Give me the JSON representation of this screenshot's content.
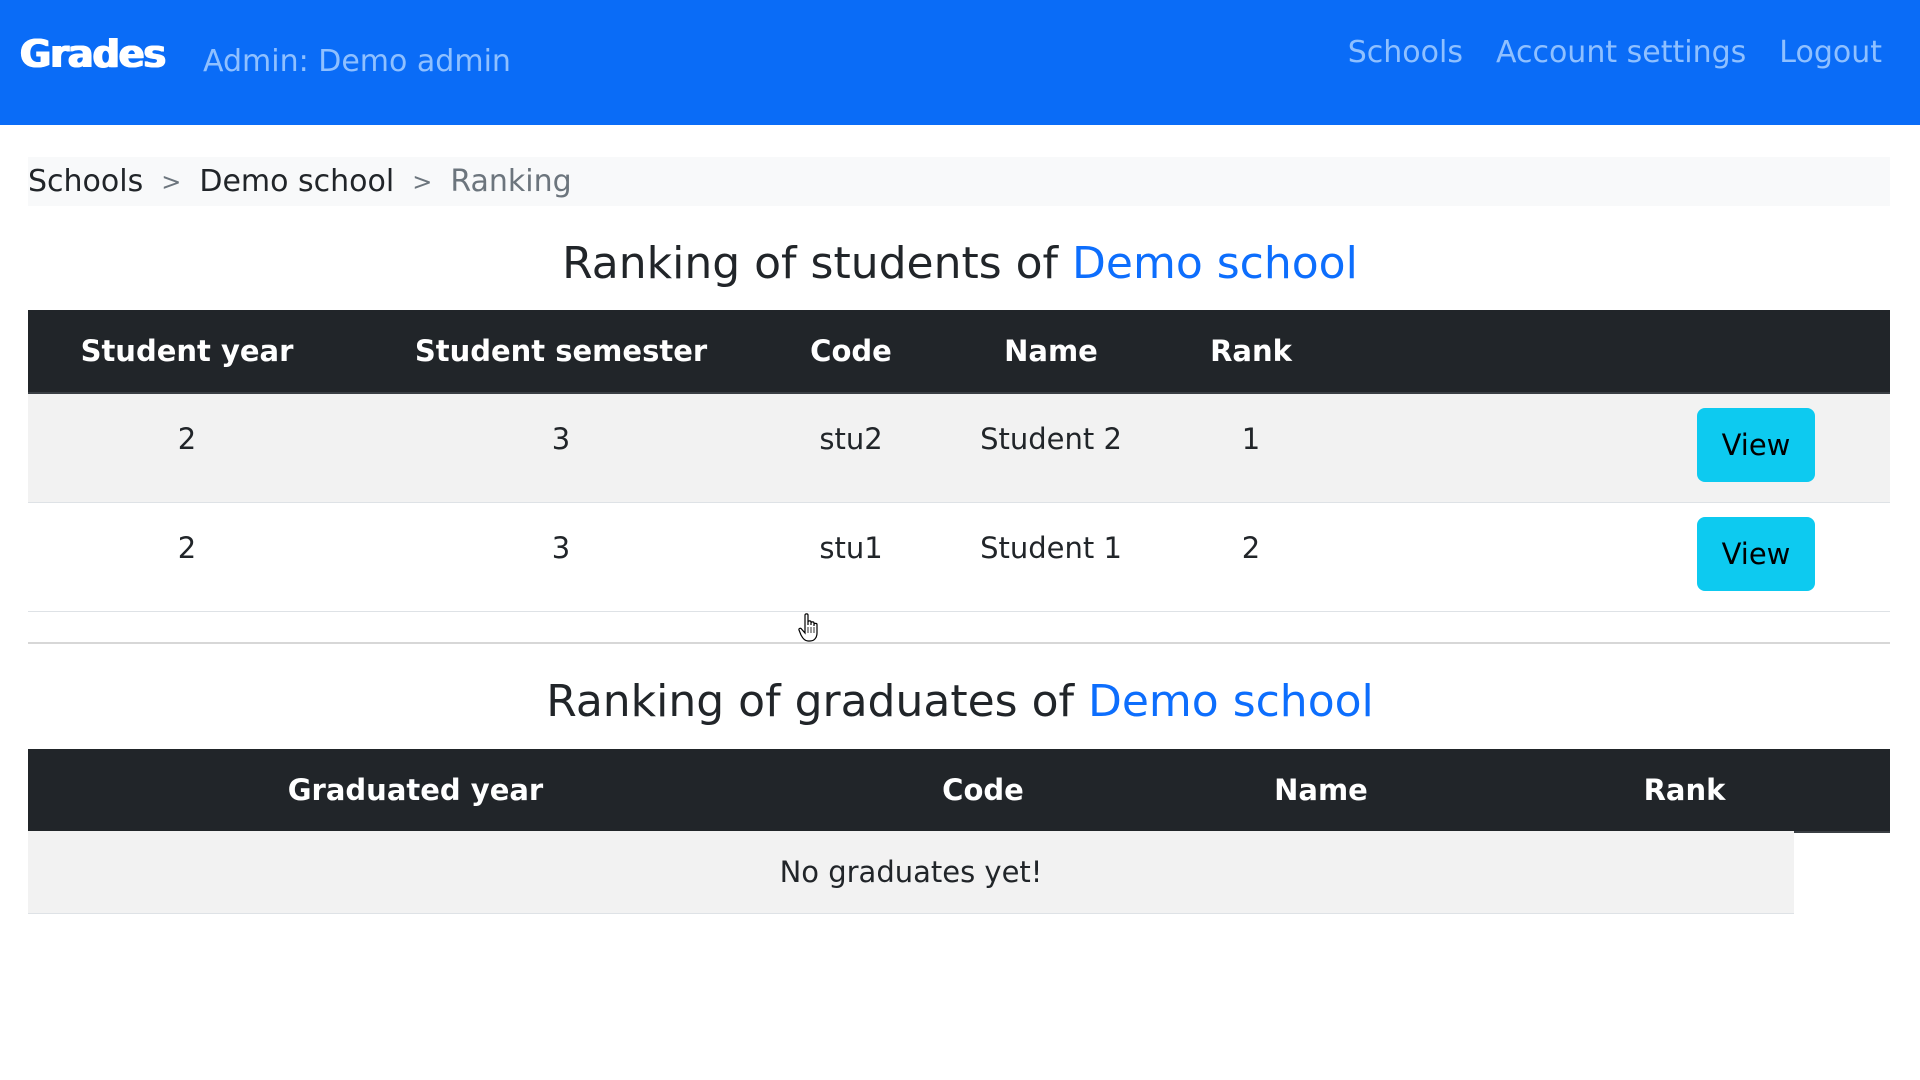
{
  "navbar": {
    "brand": "Grades",
    "admin_label": "Admin: Demo admin",
    "links": [
      "Schools",
      "Account settings",
      "Logout"
    ]
  },
  "breadcrumb": {
    "items": [
      "Schools",
      "Demo school",
      "Ranking"
    ],
    "separator": ">"
  },
  "students_section": {
    "title_prefix": "Ranking of students of ",
    "school_name": "Demo school",
    "columns": [
      "Student year",
      "Student semester",
      "Code",
      "Name",
      "Rank",
      ""
    ],
    "rows": [
      {
        "year": "2",
        "semester": "3",
        "code": "stu2",
        "name": "Student 2",
        "rank": "1",
        "action": "View"
      },
      {
        "year": "2",
        "semester": "3",
        "code": "stu1",
        "name": "Student 1",
        "rank": "2",
        "action": "View"
      }
    ]
  },
  "graduates_section": {
    "title_prefix": "Ranking of graduates of ",
    "school_name": "Demo school",
    "columns": [
      "Graduated year",
      "Code",
      "Name",
      "Rank"
    ],
    "empty_message": "No graduates yet!"
  },
  "colors": {
    "navbar_bg": "#0a6cf7",
    "link_blue": "#0d6efd",
    "table_header_bg": "#212529",
    "view_button_bg": "#0dcaf0"
  }
}
